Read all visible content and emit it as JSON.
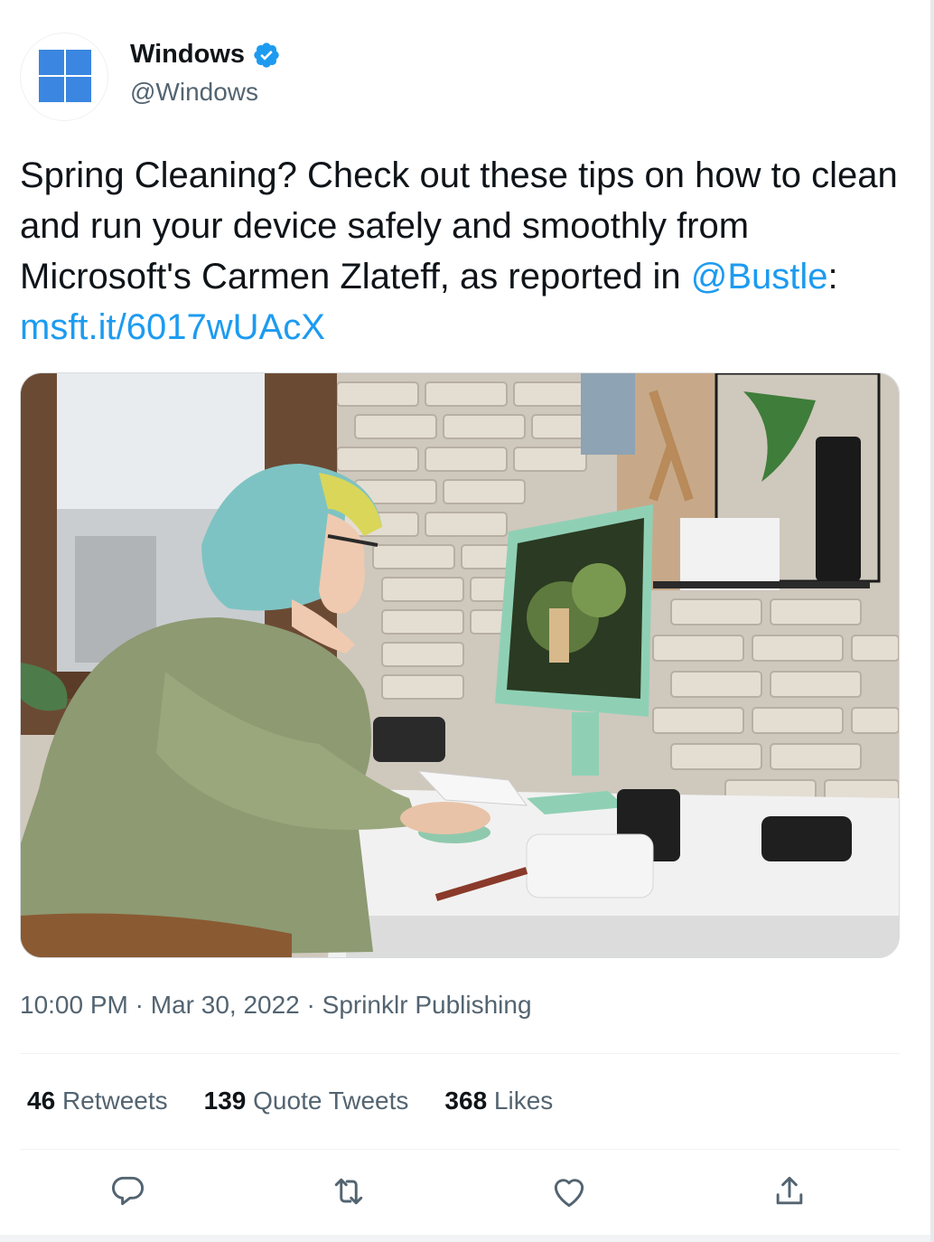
{
  "author": {
    "display_name": "Windows",
    "handle": "@Windows",
    "verified": true,
    "avatar_icon": "windows-logo-icon",
    "brand_color": "#3a86e0"
  },
  "tweet": {
    "text_before": "Spring Cleaning? Check out these tips on how to clean and run your device safely and smoothly from Microsoft's Carmen Zlateff, as reported in ",
    "mention": "@Bustle",
    "separator": ": ",
    "link": "msft.it/6017wUAcX",
    "link_color": "#1d9bf0"
  },
  "media": {
    "description_icon": "photo-woman-at-computer"
  },
  "meta": {
    "time": "10:00 PM",
    "date": "Mar 30, 2022",
    "dot": "·",
    "source": "Sprinklr Publishing"
  },
  "stats": {
    "retweets_count": "46",
    "retweets_label": "Retweets",
    "quotes_count": "139",
    "quotes_label": "Quote Tweets",
    "likes_count": "368",
    "likes_label": "Likes"
  },
  "actions": {
    "reply_icon": "reply-icon",
    "retweet_icon": "retweet-icon",
    "like_icon": "heart-icon",
    "share_icon": "share-icon"
  }
}
